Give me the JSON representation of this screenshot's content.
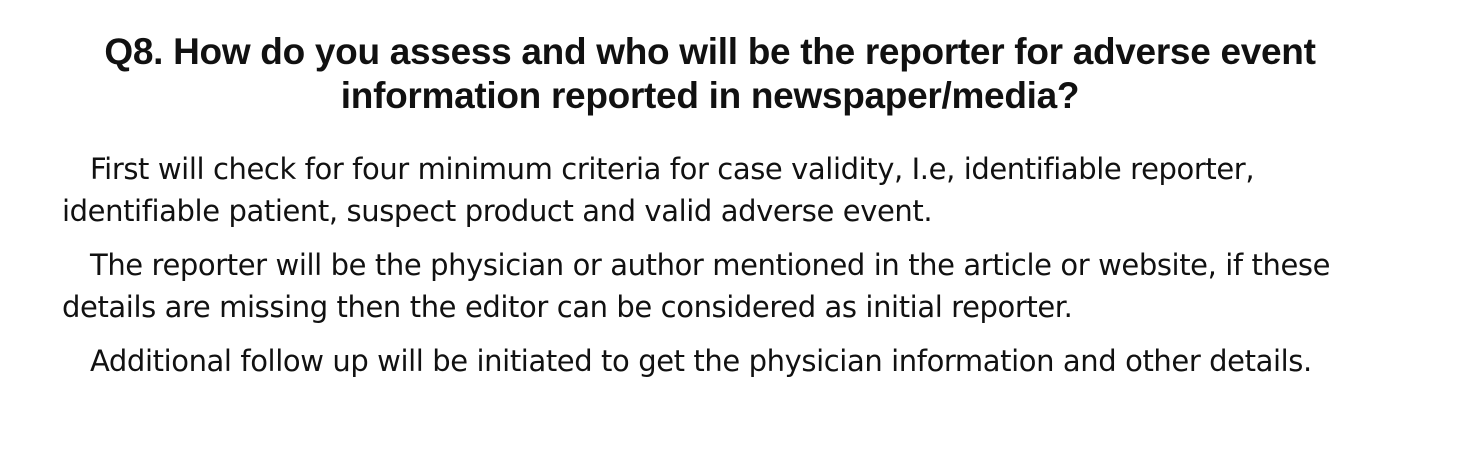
{
  "question": {
    "number": "Q8.",
    "text": "How do you assess and who will be the reporter for adverse event information reported in newspaper/media?"
  },
  "paragraphs": [
    "First will check for four minimum criteria for case validity, I.e, identifiable reporter, identifiable patient, suspect product and valid adverse event.",
    "The reporter will be the physician or author mentioned in the article or website, if these details are missing then the editor can be considered as initial reporter.",
    "Additional follow up will be initiated to get the physician information and other details."
  ]
}
